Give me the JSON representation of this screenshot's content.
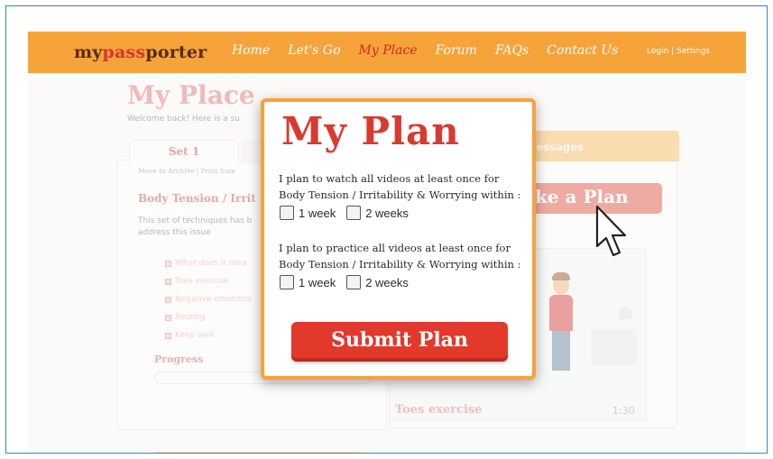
{
  "colors": {
    "frame": "#2e8ab7",
    "nav_bg": "#f6a33a",
    "brand_red": "#d83a30",
    "logo_brown": "#5a2b10"
  },
  "header": {
    "logo_part1": "my",
    "logo_part2": "pass",
    "logo_part3": "porter",
    "nav": [
      "Home",
      "Let's Go",
      "My Place",
      "Forum",
      "FAQs",
      "Contact Us"
    ],
    "active_nav": "My Place",
    "login": "Login | Settings"
  },
  "page": {
    "title": "My Place",
    "welcome": "Welcome back! Here is a su",
    "tab_active": "Set 1",
    "archive_links": "Move to Archive | Print Sum",
    "set_title": "Body Tension / Irrit",
    "set_desc": "This set of techniques has b address this issue",
    "techniques": [
      "What does it mea",
      "Toes exercise",
      "Negative emotions",
      "Resting",
      "Keep well"
    ],
    "progress_label": "Progress",
    "messages_tab": "essages",
    "make_plan_btn": "ke a Plan",
    "video_title": "Toes exercise",
    "video_duration": "1:30"
  },
  "modal": {
    "title": "My Plan",
    "q1_line1": "I plan to watch all videos  at least once for",
    "q1_line2": "Body Tension / Irritability & Worrying within :",
    "q2_line1": "I plan to practice all videos at least once  for",
    "q2_line2": "Body Tension / Irritability & Worrying within :",
    "option_1": "1 week",
    "option_2": "2 weeks",
    "submit": "Submit Plan"
  },
  "icons": {
    "cursor": "mouse-pointer-icon",
    "checkbox": "checkbox-icon"
  }
}
